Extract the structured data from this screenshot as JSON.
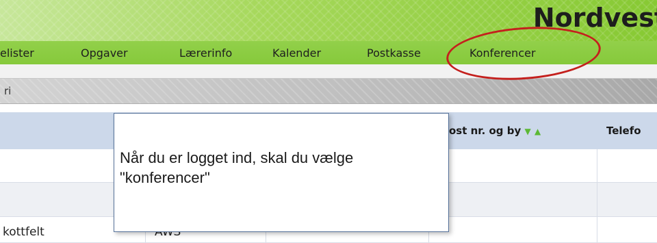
{
  "header": {
    "school_title": "Nordvest"
  },
  "nav": {
    "items": [
      {
        "label": "elister"
      },
      {
        "label": "Opgaver"
      },
      {
        "label": "Lærerinfo"
      },
      {
        "label": "Kalender"
      },
      {
        "label": "Postkasse"
      },
      {
        "label": "Konferencer"
      }
    ]
  },
  "breadcrumb": {
    "text": "ri"
  },
  "table": {
    "headers": {
      "postal": "ost nr. og by",
      "phone": "Telefo",
      "sort_down": "▼",
      "sort_up": "▲"
    },
    "rows": [
      {
        "col1": "",
        "col2": ""
      },
      {
        "col1": "",
        "col2": ""
      },
      {
        "col1": "kottfelt",
        "col2": "AWS"
      }
    ]
  },
  "callout": {
    "text": "Når du er logget ind, skal du vælge \"konferencer\""
  },
  "colors": {
    "annotation": "#c4201d",
    "nav_green": "#86c93b",
    "table_header": "#ccd8ea"
  }
}
